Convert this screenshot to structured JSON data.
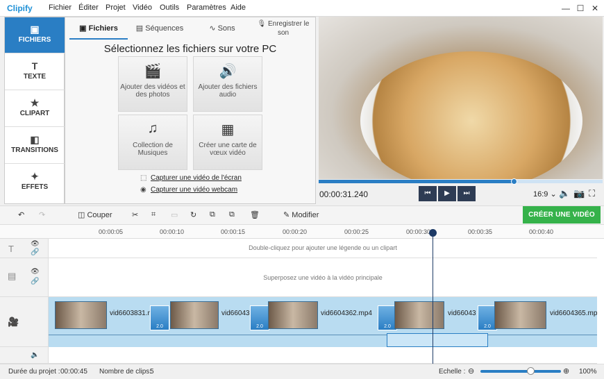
{
  "app": {
    "logo": "Clipify"
  },
  "menu": [
    "Fichier",
    "Éditer",
    "Projet",
    "Vidéo",
    "Outils",
    "Paramètres",
    "Aide"
  ],
  "window_controls": {
    "minimize": "—",
    "maximize": "☐",
    "close": "✕"
  },
  "sidebar": {
    "items": [
      {
        "label": "FICHIERS",
        "icon": "image-icon",
        "glyph": "▣"
      },
      {
        "label": "TEXTE",
        "icon": "text-icon",
        "glyph": "T"
      },
      {
        "label": "CLIPART",
        "icon": "star-icon",
        "glyph": "★"
      },
      {
        "label": "TRANSITIONS",
        "icon": "transitions-icon",
        "glyph": "◧"
      },
      {
        "label": "EFFETS",
        "icon": "effects-icon",
        "glyph": "✦"
      }
    ]
  },
  "tabs": [
    {
      "label": "Fichiers",
      "icon": "image-icon",
      "glyph": "▣"
    },
    {
      "label": "Séquences",
      "icon": "film-icon",
      "glyph": "▤"
    },
    {
      "label": "Sons",
      "icon": "audio-wave-icon",
      "glyph": "∿"
    },
    {
      "label": "Enregistrer le son",
      "icon": "microphone-icon",
      "glyph": "🎙"
    }
  ],
  "panel": {
    "title": "Sélectionnez les fichiers sur votre PC",
    "tiles": [
      {
        "label": "Ajouter des vidéos et des photos",
        "icon": "film-clapper-icon",
        "glyph": "🎬"
      },
      {
        "label": "Ajouter des fichiers audio",
        "icon": "audio-file-icon",
        "glyph": "🔊"
      },
      {
        "label": "Collection de Musiques",
        "icon": "music-note-icon",
        "glyph": "♫"
      },
      {
        "label": "Créer une carte de vœux vidéo",
        "icon": "card-icon",
        "glyph": "▦"
      }
    ],
    "links": [
      {
        "label": "Capturer une vidéo de l'écran",
        "icon": "screen-capture-icon",
        "glyph": "⬚"
      },
      {
        "label": "Capturer une vidéo webcam",
        "icon": "webcam-icon",
        "glyph": "◉"
      }
    ]
  },
  "player": {
    "timecode": "00:00:31.240",
    "progress_fraction": 0.69,
    "aspect_ratio": "16:9",
    "buttons": {
      "prev": "⏮",
      "play": "▶",
      "next": "⏭"
    }
  },
  "toolbar": {
    "cut_label": "Couper",
    "edit_label": "Modifier",
    "create_label": "CRÉER UNE VIDÉO"
  },
  "ruler": [
    "00:00:05",
    "00:00:10",
    "00:00:15",
    "00:00:20",
    "00:00:25",
    "00:00:30",
    "00:00:35",
    "00:00:40"
  ],
  "tracks": {
    "text_hint": "Double-cliquez pour ajouter une légende ou un clipart",
    "overlay_hint": "Superposez une vidéo à la vidéo principale"
  },
  "clips": [
    {
      "label": "vid6603831.n"
    },
    {
      "label": "vid66043"
    },
    {
      "label": "vid6604362.mp4"
    },
    {
      "label": "vid66043"
    },
    {
      "label": "vid6604365.mp"
    }
  ],
  "transition_duration": "2.0",
  "status": {
    "duration_label": "Durée du projet :",
    "duration_value": "00:00:45",
    "clips_label": "Nombre de clips:",
    "clips_value": "5",
    "scale_label": "Echelle :",
    "zoom_value": "100%"
  },
  "colors": {
    "accent": "#2a7ec4",
    "create": "#35b24a",
    "timeline": "#b9dcf1"
  }
}
